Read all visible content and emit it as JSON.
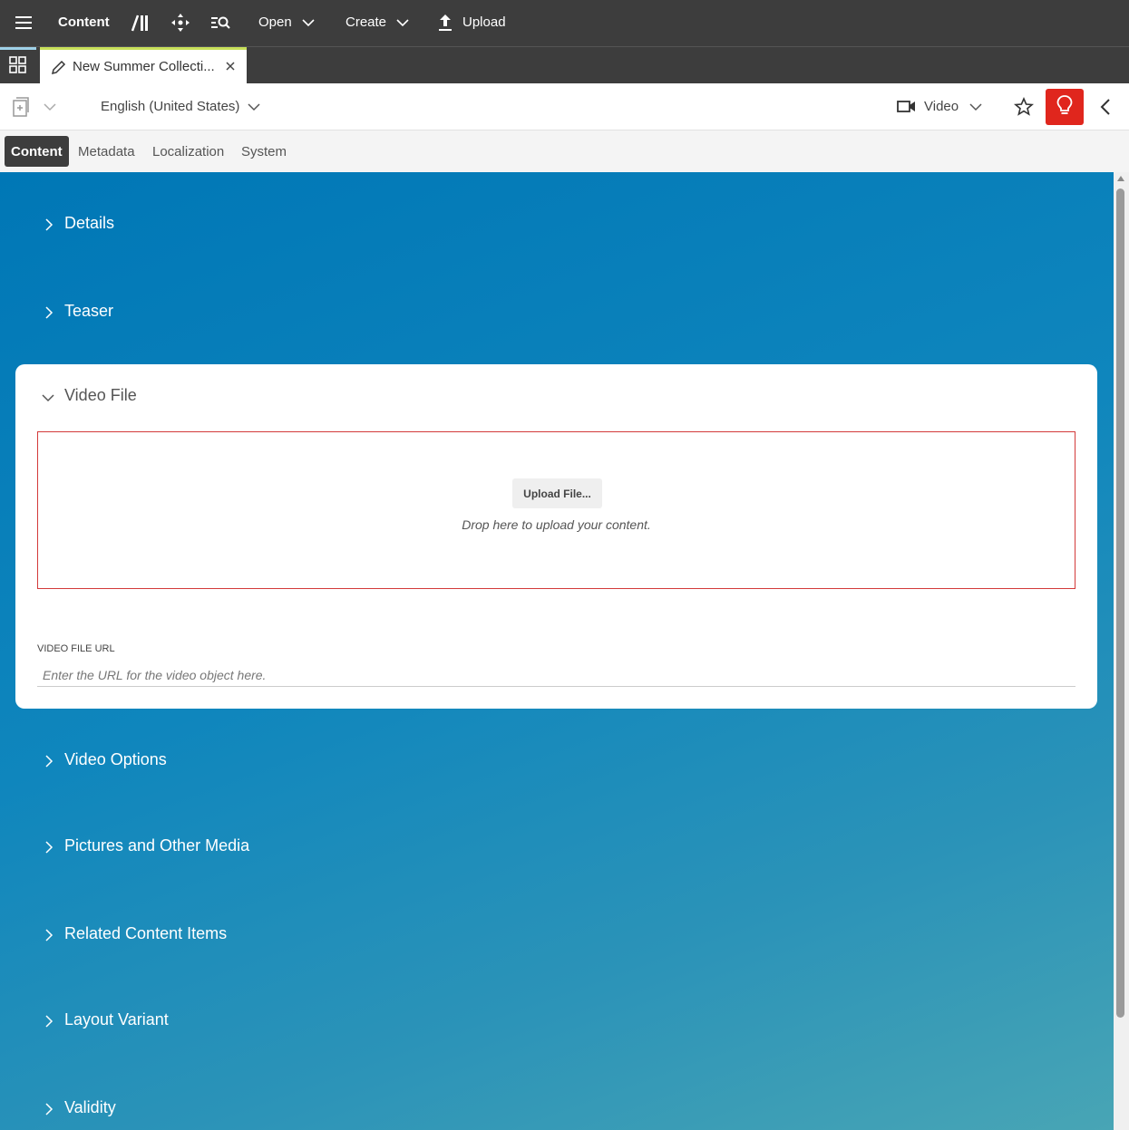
{
  "topbar": {
    "brand": "Content",
    "open_label": "Open",
    "create_label": "Create",
    "upload_label": "Upload"
  },
  "tabstrip": {
    "active_tab_title": "New Summer Collecti..."
  },
  "toolbar": {
    "language": "English (United States)",
    "content_type": "Video"
  },
  "subtabs": [
    "Content",
    "Metadata",
    "Localization",
    "System"
  ],
  "sections": {
    "details": "Details",
    "teaser": "Teaser",
    "video_file": "Video File",
    "video_options": "Video Options",
    "pictures": "Pictures and Other Media",
    "related": "Related Content Items",
    "layout": "Layout Variant",
    "validity": "Validity"
  },
  "video_file": {
    "upload_button": "Upload File...",
    "drop_hint": "Drop here to upload your content.",
    "url_label": "VIDEO FILE URL",
    "url_placeholder": "Enter the URL for the video object here.",
    "url_value": ""
  },
  "colors": {
    "topbar": "#3d3d3d",
    "accent_red": "#e0261d",
    "main_gradient_start": "#0077b6",
    "main_gradient_end": "#48a5b5",
    "dropzone_border": "#d33a3a"
  }
}
